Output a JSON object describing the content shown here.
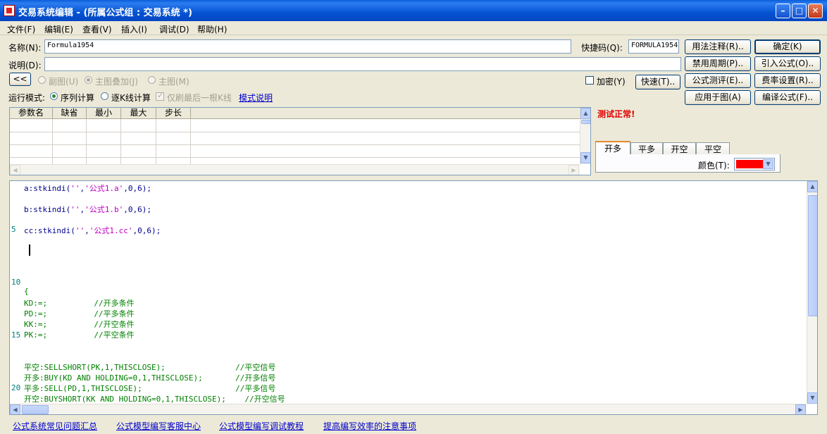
{
  "window": {
    "title": "交易系统编辑 - (所属公式组 : 交易系统 *)"
  },
  "menu": [
    "文件(F)",
    "编辑(E)",
    "查看(V)",
    "插入(I)",
    "调试(D)",
    "帮助(H)"
  ],
  "form": {
    "name_label": "名称(N):",
    "name_value": "Formula1954",
    "shortcut_label": "快捷码(Q):",
    "shortcut_value": "FORMULA1954",
    "desc_label": "说明(D):",
    "desc_value": "",
    "collapse_label": "<<",
    "chart_options": [
      "副图(U)",
      "主图叠加(J)",
      "主图(M)"
    ],
    "chart_option_selected": "主图叠加(J)",
    "encrypt_label": "加密(Y)",
    "run_mode_label": "运行模式:",
    "run_modes": [
      "序列计算",
      "逐K线计算"
    ],
    "run_mode_selected": "序列计算",
    "last_bar_only_label": "仅刷最后一根K线",
    "mode_help_link": "模式说明"
  },
  "buttons": {
    "usage": "用法注释(R)..",
    "ok": "确定(K)",
    "disable_period": "禁用周期(P)..",
    "import": "引入公式(O)..",
    "quick": "快速(T)..",
    "test": "公式测评(E)..",
    "fee": "费率设置(R)..",
    "apply": "应用于图(A)",
    "compile": "编译公式(F).."
  },
  "param_table": {
    "columns": [
      "参数名",
      "缺省",
      "最小",
      "最大",
      "步长"
    ],
    "rows": []
  },
  "status_text": "测试正常!",
  "signal_tabs": [
    "开多",
    "平多",
    "开空",
    "平空"
  ],
  "signal_tab_selected": "开多",
  "color_label": "颜色(T):",
  "color_value": "#ff0000",
  "editor": {
    "line_numbers": [
      "5",
      "10",
      "15",
      "20"
    ],
    "lines": [
      {
        "pre": "a:stkindi(",
        "s1": "''",
        "mid": ",",
        "s2": "'公式1.a'",
        "post": ",0,6);"
      },
      {
        "pre": "b:stkindi(",
        "s1": "''",
        "mid": ",",
        "s2": "'公式1.b'",
        "post": ",0,6);"
      },
      {
        "pre": "cc:stkindi(",
        "s1": "''",
        "mid": ",",
        "s2": "'公式1.cc'",
        "post": ",0,6);"
      }
    ],
    "brace": "{",
    "conditions": [
      "KD:=;          //开多条件",
      "PD:=;          //平多条件",
      "KK:=;          //开空条件",
      "PK:=;          //平空条件"
    ],
    "signals": [
      "平空:SELLSHORT(PK,1,THISCLOSE);               //平空信号",
      "开多:BUY(KD AND HOLDING=0,1,THISCLOSE);       //开多信号",
      "平多:SELL(PD,1,THISCLOSE);                    //平多信号",
      "开空:BUYSHORT(KK AND HOLDING=0,1,THISCLOSE);    //开空信号"
    ]
  },
  "footer_links": [
    "公式系统常见问题汇总",
    "公式模型编写客服中心",
    "公式模型编写调试教程",
    "提高编写效率的注意事项"
  ]
}
